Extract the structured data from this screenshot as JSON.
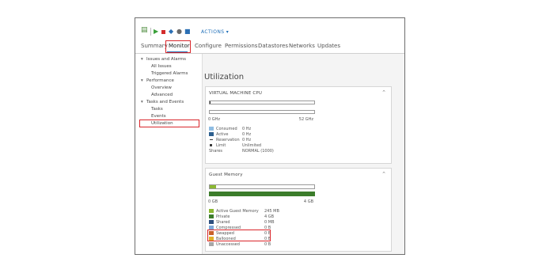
{
  "toolbar": {
    "actions_label": "ACTIONS ▾"
  },
  "tabs": [
    {
      "label": "Summary"
    },
    {
      "label": "Monitor"
    },
    {
      "label": "Configure"
    },
    {
      "label": "Permissions"
    },
    {
      "label": "Datastores"
    },
    {
      "label": "Networks"
    },
    {
      "label": "Updates"
    }
  ],
  "sidebar": {
    "items": [
      {
        "label": "Issues and Alarms",
        "caret": "▾"
      },
      {
        "label": "All Issues"
      },
      {
        "label": "Triggered Alarms"
      },
      {
        "label": "Performance",
        "caret": "▾"
      },
      {
        "label": "Overview"
      },
      {
        "label": "Advanced"
      },
      {
        "label": "Tasks and Events",
        "caret": "▾"
      },
      {
        "label": "Tasks"
      },
      {
        "label": "Events"
      },
      {
        "label": "Utilization"
      }
    ]
  },
  "main": {
    "title": "Utilization",
    "cpu_panel": {
      "title": "VIRTUAL MACHINE CPU",
      "scale_min": "0 GHz",
      "scale_max": "52 GHz",
      "legend": [
        {
          "label": "Consumed",
          "value": "0 Hz",
          "color": "#8fbde3"
        },
        {
          "label": "Active",
          "value": "0 Hz",
          "color": "#2d5f8f"
        },
        {
          "label": "Reservation",
          "value": "0 Hz",
          "color": "#3a3a3a"
        },
        {
          "label": "Limit",
          "value": "Unlimited",
          "color": "#3a3a3a"
        },
        {
          "label": "Shares",
          "value": "NORMAL (1000)",
          "color": ""
        }
      ]
    },
    "memory_panel": {
      "title": "Guest Memory",
      "scale_min": "0 GB",
      "scale_max": "4 GB",
      "fill_fraction": 0.06,
      "legend": [
        {
          "label": "Active Guest Memory",
          "value": "245 MB",
          "color": "#8bb832"
        },
        {
          "label": "Private",
          "value": "4 GB",
          "color": "#3c7d2b"
        },
        {
          "label": "Shared",
          "value": "0 MB",
          "color": "#2c4f7f"
        },
        {
          "label": "Compressed",
          "value": "0 B",
          "color": "#7ea8d8"
        },
        {
          "label": "Swapped",
          "value": "0 B",
          "color": "#c9602a"
        },
        {
          "label": "Ballooned",
          "value": "0 B",
          "color": "#e0b12a"
        },
        {
          "label": "Unaccessed",
          "value": "0 B",
          "color": "#a7a7a7"
        }
      ]
    }
  }
}
